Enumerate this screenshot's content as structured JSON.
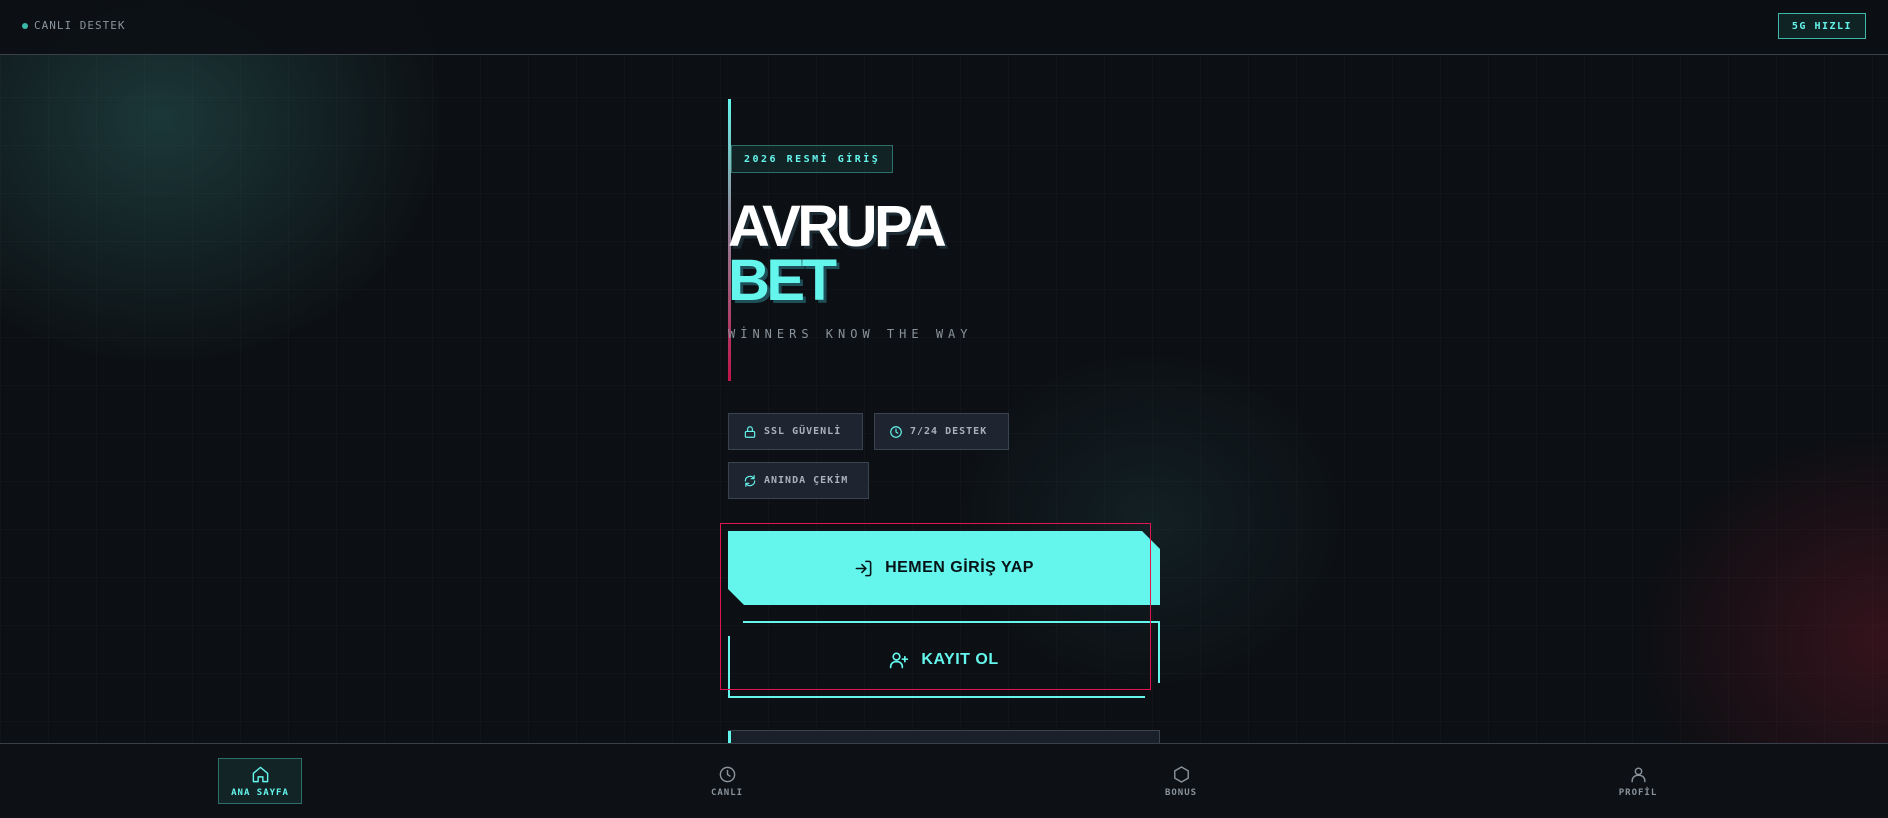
{
  "topbar": {
    "support_label": "CANLI DESTEK",
    "speed_badge": "5G HIZLI"
  },
  "hero": {
    "tag": "2026 RESMİ GİRİŞ",
    "title_line1": "AVRUPA",
    "title_line2": "BET",
    "tagline": "WİNNERS KNOW THE WAY"
  },
  "features": [
    {
      "icon": "lock-icon",
      "label": "SSL GÜVENLİ"
    },
    {
      "icon": "clock-icon",
      "label": "7/24 DESTEK"
    },
    {
      "icon": "refresh-icon",
      "label": "ANINDA ÇEKİM"
    }
  ],
  "actions": {
    "login_label": "HEMEN GİRİŞ YAP",
    "register_label": "KAYIT OL"
  },
  "bottom_nav": [
    {
      "icon": "home-icon",
      "label": "ANA SAYFA",
      "active": true
    },
    {
      "icon": "clock-icon",
      "label": "CANLI",
      "active": false
    },
    {
      "icon": "hexagon-icon",
      "label": "BONUS",
      "active": false
    },
    {
      "icon": "user-icon",
      "label": "PROFİL",
      "active": false
    }
  ],
  "colors": {
    "accent": "#64f5ec",
    "focus": "#e0144e",
    "background": "#0c0f13"
  }
}
